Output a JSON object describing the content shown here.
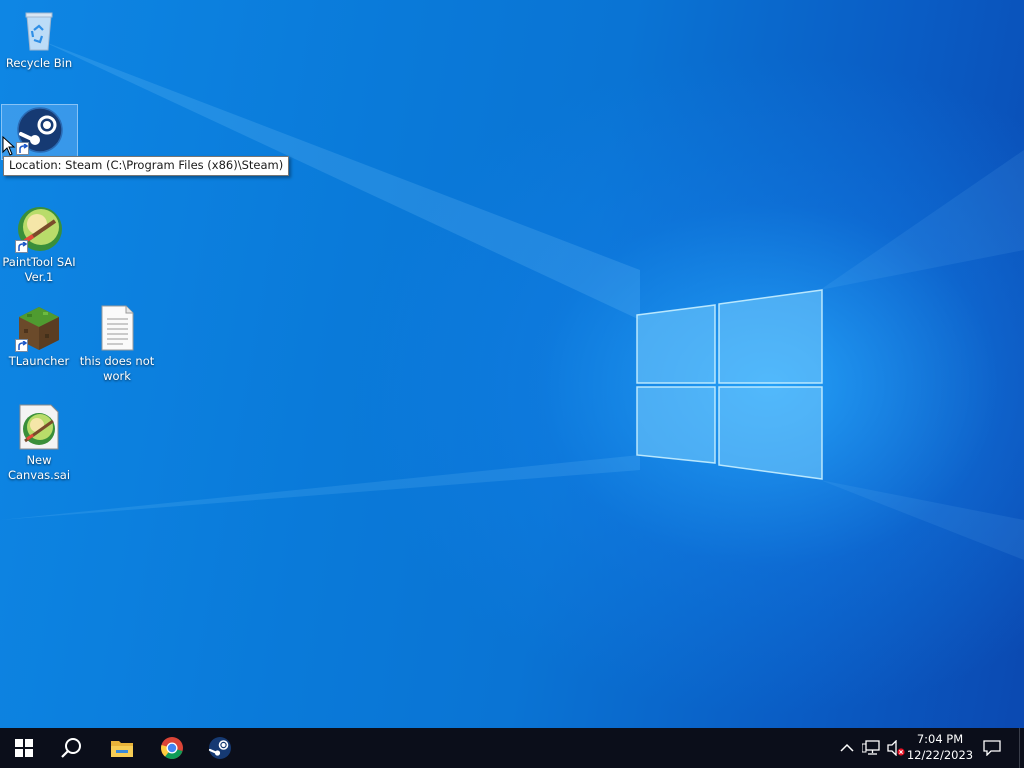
{
  "desktop": {
    "icons": [
      {
        "label": "Recycle Bin",
        "icon": "recycle-bin-icon"
      },
      {
        "label": "",
        "icon": "steam-icon",
        "selected": true
      },
      {
        "label": "PaintTool SAI Ver.1",
        "icon": "painttool-sai-icon"
      },
      {
        "label": "TLauncher",
        "icon": "tlauncher-icon"
      },
      {
        "label": "this does not work",
        "icon": "text-document-icon"
      },
      {
        "label": "New Canvas.sai",
        "icon": "sai-canvas-file-icon"
      }
    ],
    "tooltip": "Location: Steam (C:\\Program Files (x86)\\Steam)"
  },
  "taskbar": {
    "pinned": [
      "start-icon",
      "search-icon",
      "file-explorer-icon",
      "chrome-icon",
      "steam-icon"
    ],
    "tray": [
      "chevron-up-icon",
      "network-icon",
      "volume-muted-icon"
    ],
    "time": "7:04 PM",
    "date": "12/22/2023",
    "notifications_icon": "action-center-icon"
  },
  "colors": {
    "taskbar": "#0b0e1a",
    "desktop_accent": "#0a78d7"
  }
}
